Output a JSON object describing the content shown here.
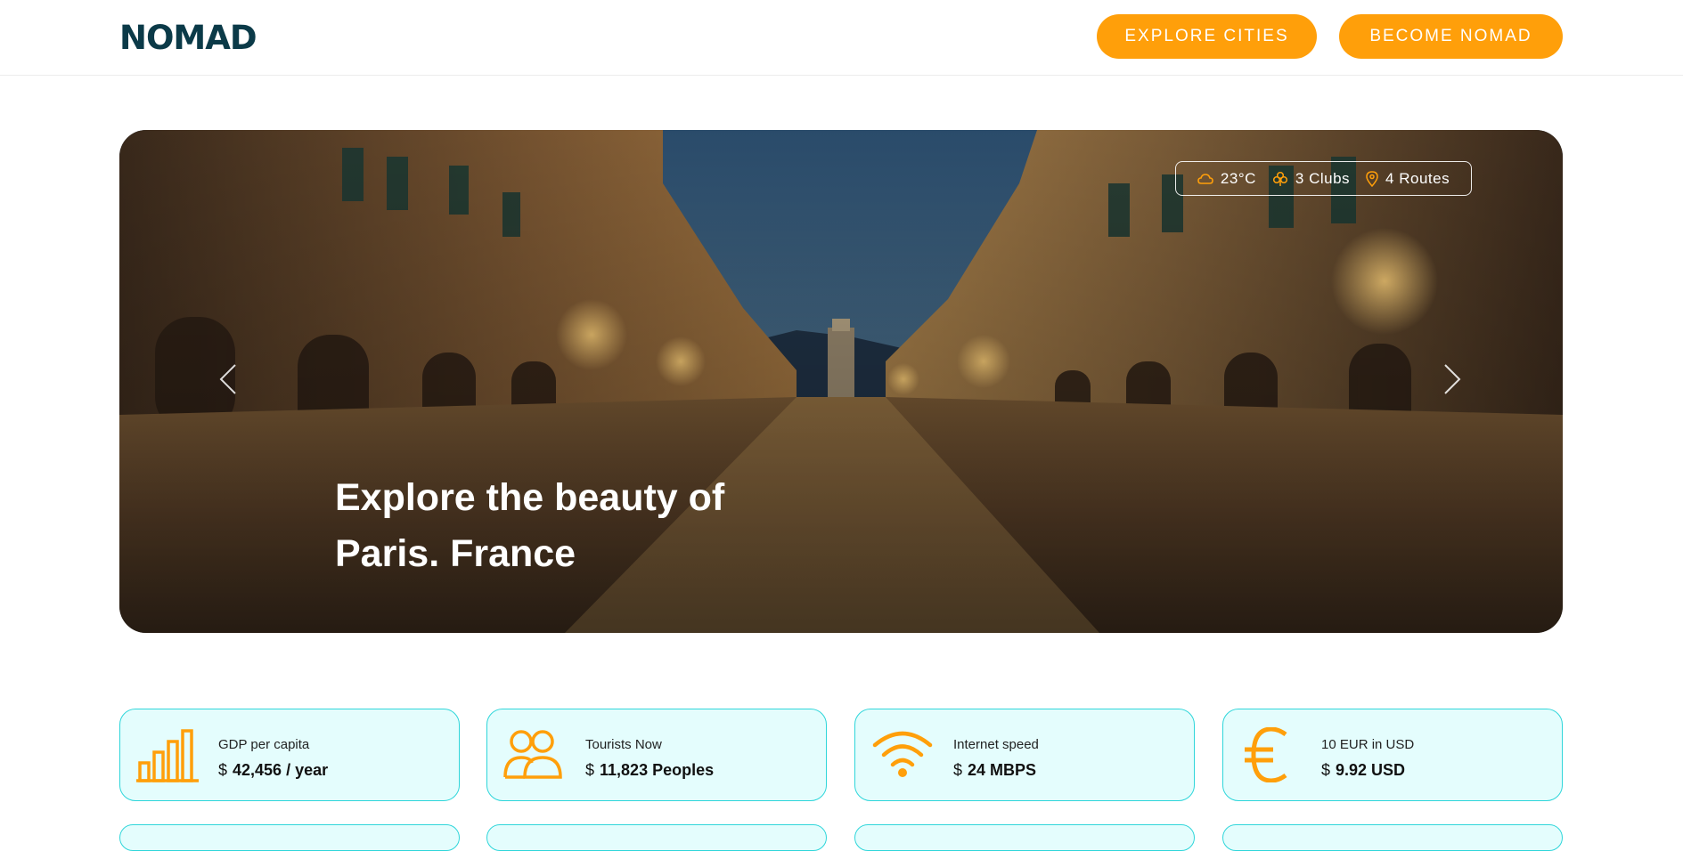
{
  "header": {
    "logo": "NOMAD",
    "explore_label": "EXPLORE CITIES",
    "become_label": "BECOME NOMAD"
  },
  "hero": {
    "title_line1": "Explore the beauty of",
    "title_line2": "Paris. France",
    "stats": {
      "temperature": "23°C",
      "clubs": "3 Clubs",
      "routes": "4 Routes"
    }
  },
  "cards": [
    {
      "label": "GDP per capita",
      "currency": "$",
      "value": "42,456 / year",
      "icon": "bar-chart-icon"
    },
    {
      "label": "Tourists Now",
      "currency": "$",
      "value": "11,823 Peoples",
      "icon": "users-icon"
    },
    {
      "label": "Internet speed",
      "currency": "$",
      "value": "24 MBPS",
      "icon": "wifi-icon"
    },
    {
      "label": "10 EUR in USD",
      "currency": "$",
      "value": "9.92 USD",
      "icon": "euro-icon"
    }
  ],
  "colors": {
    "accent": "#ff9f0a",
    "brand": "#0b3a48",
    "card_border": "#2fd6da",
    "card_bg": "#e4fdfd"
  }
}
